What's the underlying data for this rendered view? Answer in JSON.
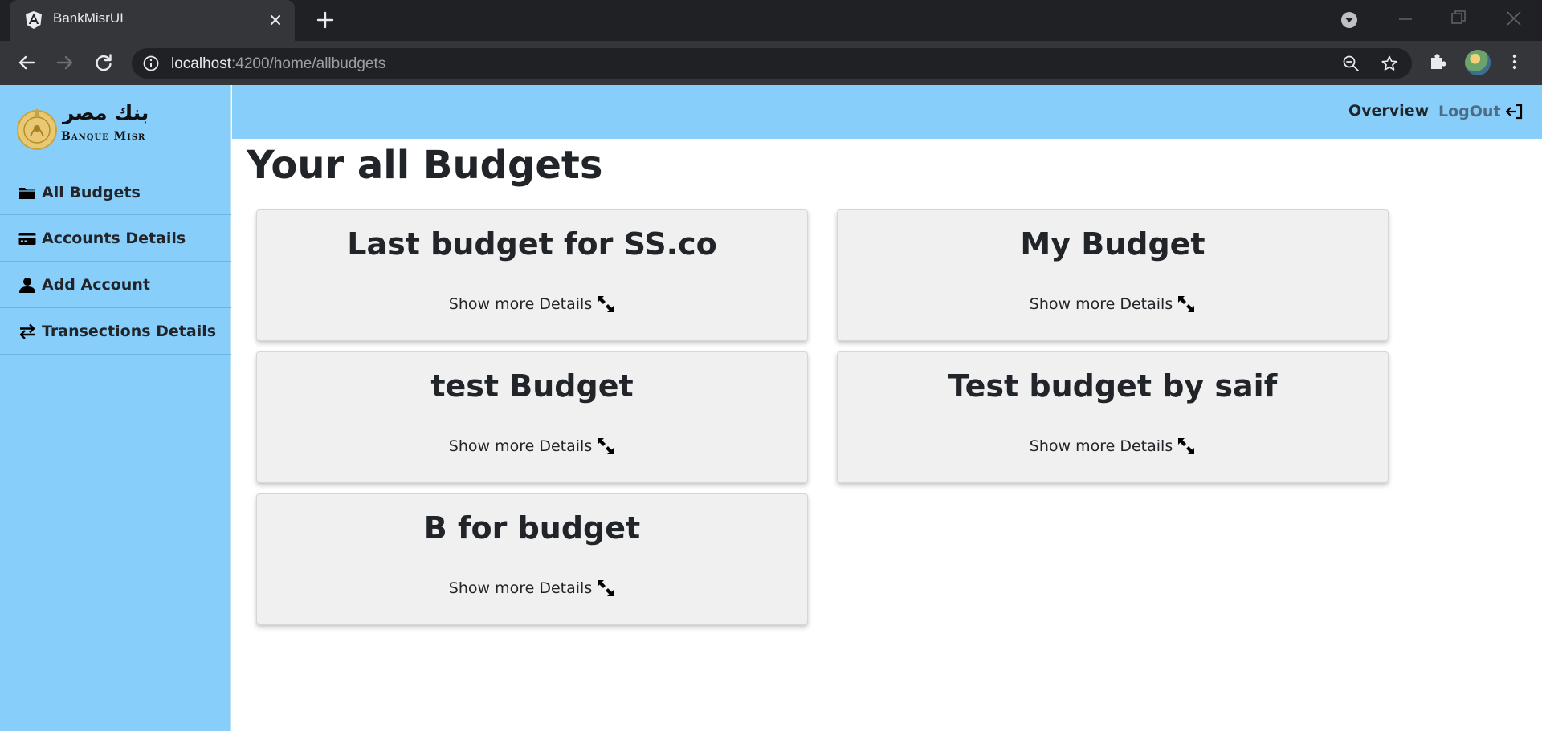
{
  "browser": {
    "tab_title": "BankMisrUI",
    "url_host": "localhost",
    "url_rest": ":4200/home/allbudgets"
  },
  "logo": {
    "arabic": "بنك مصر",
    "english": "Banque Misr"
  },
  "sidebar": {
    "items": [
      {
        "label": "All Budgets",
        "icon": "folder-icon"
      },
      {
        "label": "Accounts Details",
        "icon": "credit-card-icon"
      },
      {
        "label": "Add Account",
        "icon": "user-icon"
      },
      {
        "label": "Transections Details",
        "icon": "exchange-arrows-icon"
      }
    ]
  },
  "header": {
    "overview": "Overview",
    "logout": "LogOut"
  },
  "page": {
    "title": "Your all Budgets"
  },
  "budgets": [
    {
      "title": "Last budget for SS.co",
      "link": "Show more Details"
    },
    {
      "title": "My Budget",
      "link": "Show more Details"
    },
    {
      "title": "test Budget",
      "link": "Show more Details"
    },
    {
      "title": "Test budget by saif",
      "link": "Show more Details"
    },
    {
      "title": "B for budget",
      "link": "Show more Details"
    }
  ],
  "colors": {
    "sidebar_bg": "#87cefa",
    "card_bg": "#f0f0f0",
    "text": "#212529",
    "logout": "#4d6b82"
  }
}
